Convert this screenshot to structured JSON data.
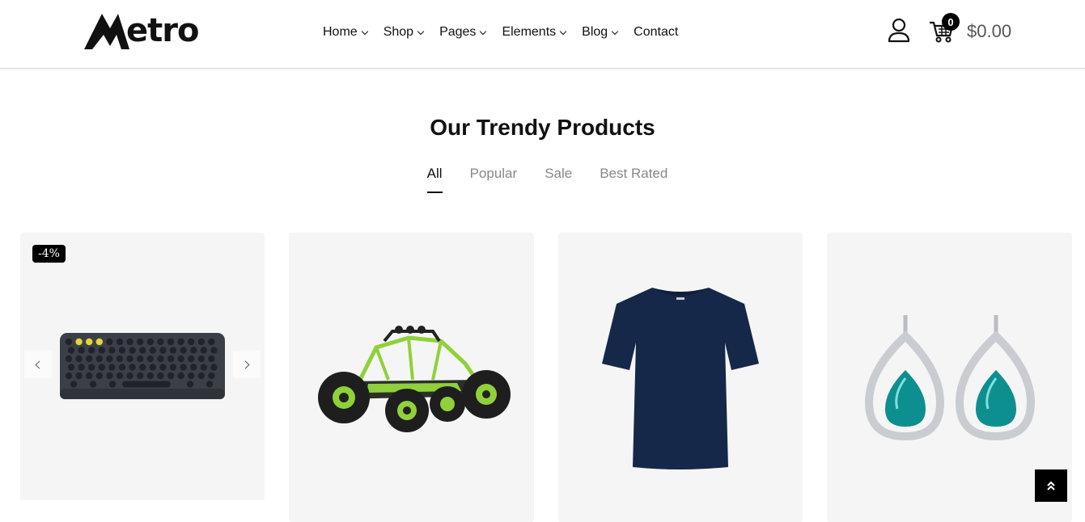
{
  "header": {
    "logo_text": "etro",
    "nav": [
      {
        "label": "Home",
        "has_dropdown": true
      },
      {
        "label": "Shop",
        "has_dropdown": true
      },
      {
        "label": "Pages",
        "has_dropdown": true
      },
      {
        "label": "Elements",
        "has_dropdown": true
      },
      {
        "label": "Blog",
        "has_dropdown": true
      },
      {
        "label": "Contact",
        "has_dropdown": false
      }
    ],
    "cart_count": "0",
    "cart_total": "$0.00"
  },
  "section": {
    "title": "Our Trendy Products",
    "tabs": [
      {
        "label": "All",
        "active": true
      },
      {
        "label": "Popular",
        "active": false
      },
      {
        "label": "Sale",
        "active": false
      },
      {
        "label": "Best Rated",
        "active": false
      }
    ]
  },
  "products": [
    {
      "badge": "-4%",
      "image": "keyboard"
    },
    {
      "image": "rc-buggy"
    },
    {
      "image": "navy-t-shirt"
    },
    {
      "image": "teal-drop-earrings"
    }
  ],
  "colors": {
    "brand": "#111111",
    "card_bg": "#f5f5f5",
    "tab_inactive": "#888888",
    "tshirt": "#15284a",
    "gem": "#0d8f8f",
    "buggy_accent": "#8fd13a"
  }
}
